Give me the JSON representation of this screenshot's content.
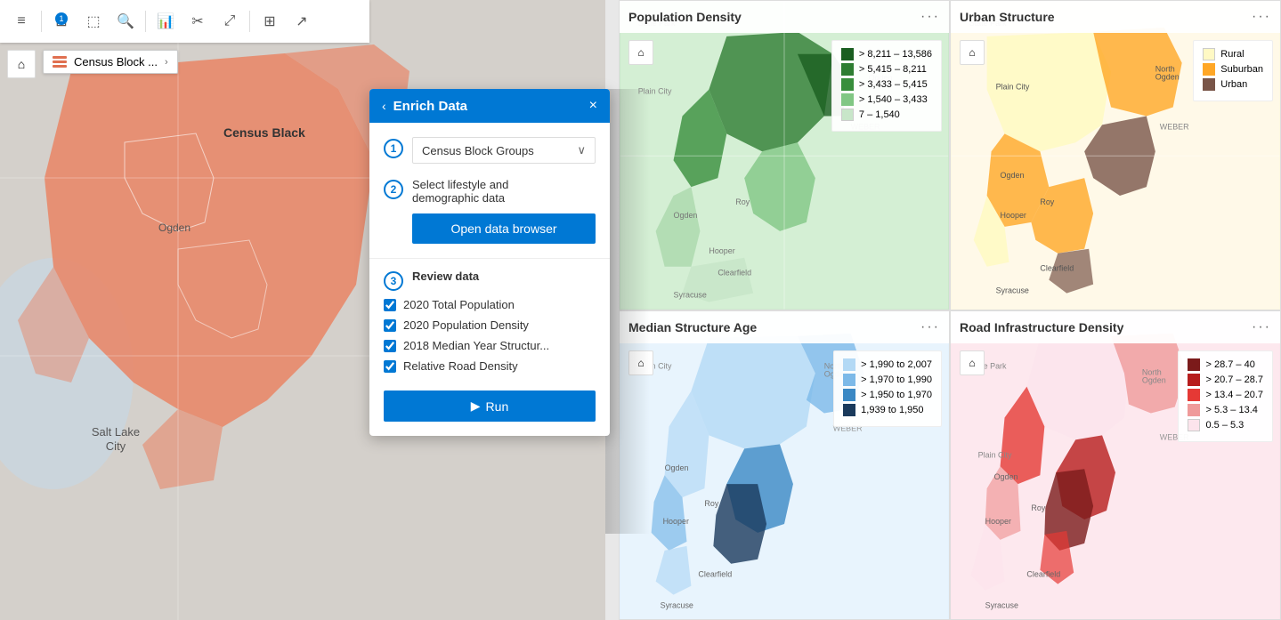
{
  "toolbar": {
    "buttons": [
      {
        "name": "menu-icon",
        "icon": "☰"
      },
      {
        "name": "filter-icon",
        "icon": "⊞"
      },
      {
        "name": "select-icon",
        "icon": "⬚"
      },
      {
        "name": "zoom-in-icon",
        "icon": "⊕"
      },
      {
        "name": "chart-icon",
        "icon": "▦"
      },
      {
        "name": "tools-icon",
        "icon": "✂"
      },
      {
        "name": "fullscreen-icon",
        "icon": "⤢"
      },
      {
        "name": "layers-icon",
        "icon": "⊞"
      },
      {
        "name": "share-icon",
        "icon": "↗"
      }
    ],
    "badge_count": "1"
  },
  "layer_selector": {
    "label": "Census Block ...",
    "chevron": "›"
  },
  "enrich_panel": {
    "title": "Enrich Data",
    "step1": {
      "number": "1",
      "dropdown_value": "Census Block Groups"
    },
    "step2": {
      "number": "2",
      "label": "Select lifestyle and\ndemographic data",
      "button_label": "Open data browser"
    },
    "step3": {
      "number": "3",
      "label": "Review data",
      "checkboxes": [
        {
          "label": "2020 Total Population",
          "checked": true
        },
        {
          "label": "2020 Population Density",
          "checked": true
        },
        {
          "label": "2018 Median Year Structur...",
          "checked": true
        },
        {
          "label": "Relative Road Density",
          "checked": true
        }
      ]
    },
    "run_button_label": "Run"
  },
  "map_cards": [
    {
      "id": "population-density",
      "title": "Population Density",
      "bg_color": "#c8e6c9",
      "legend": [
        {
          "color": "#1a5e20",
          "label": "> 8,211 – 13,586"
        },
        {
          "color": "#2e7d32",
          "label": "> 5,415 – 8,211"
        },
        {
          "color": "#388e3c",
          "label": "> 3,433 – 5,415"
        },
        {
          "color": "#81c784",
          "label": "> 1,540 – 3,433"
        },
        {
          "color": "#c8e6c9",
          "label": "7 – 1,540"
        }
      ]
    },
    {
      "id": "urban-structure",
      "title": "Urban Structure",
      "bg_color": "#fff8e1",
      "legend": [
        {
          "color": "#fff9c4",
          "label": "Rural"
        },
        {
          "color": "#ffa726",
          "label": "Suburban"
        },
        {
          "color": "#795548",
          "label": "Urban"
        }
      ]
    },
    {
      "id": "median-structure-age",
      "title": "Median Structure Age",
      "bg_color": "#e3f2fd",
      "legend": [
        {
          "color": "#b3d9f5",
          "label": "> 1,990 to 2,007"
        },
        {
          "color": "#7cb9e8",
          "label": "> 1,970 to 1,990"
        },
        {
          "color": "#3a88c4",
          "label": "> 1,950 to 1,970"
        },
        {
          "color": "#1a3a5c",
          "label": "1,939 to 1,950"
        }
      ]
    },
    {
      "id": "road-infrastructure-density",
      "title": "Road Infrastructure Density",
      "bg_color": "#fce4ec",
      "legend": [
        {
          "color": "#7b1a1a",
          "label": "> 28.7 – 40"
        },
        {
          "color": "#b71c1c",
          "label": "> 20.7 – 28.7"
        },
        {
          "color": "#e53935",
          "label": "> 13.4 – 20.7"
        },
        {
          "color": "#ef9a9a",
          "label": "> 5.3 – 13.4"
        },
        {
          "color": "#fce4ec",
          "label": "0.5 – 5.3"
        }
      ]
    }
  ],
  "map_labels": {
    "state_park": "State Park",
    "plain_city": "Plain City",
    "north_ogden": "North\nOgden",
    "weber": "WEBER",
    "ogden": "Ogden",
    "hooper": "Hooper",
    "ray": "Roy",
    "clearfield": "Clearfield",
    "syracuse": "Syracuse",
    "salt_lake_city": "Salt Lake\nCity"
  },
  "icons": {
    "home": "⌂",
    "back": "‹",
    "close": "×",
    "chevron_down": "∨",
    "run_play": "▶",
    "ellipsis": "···"
  }
}
